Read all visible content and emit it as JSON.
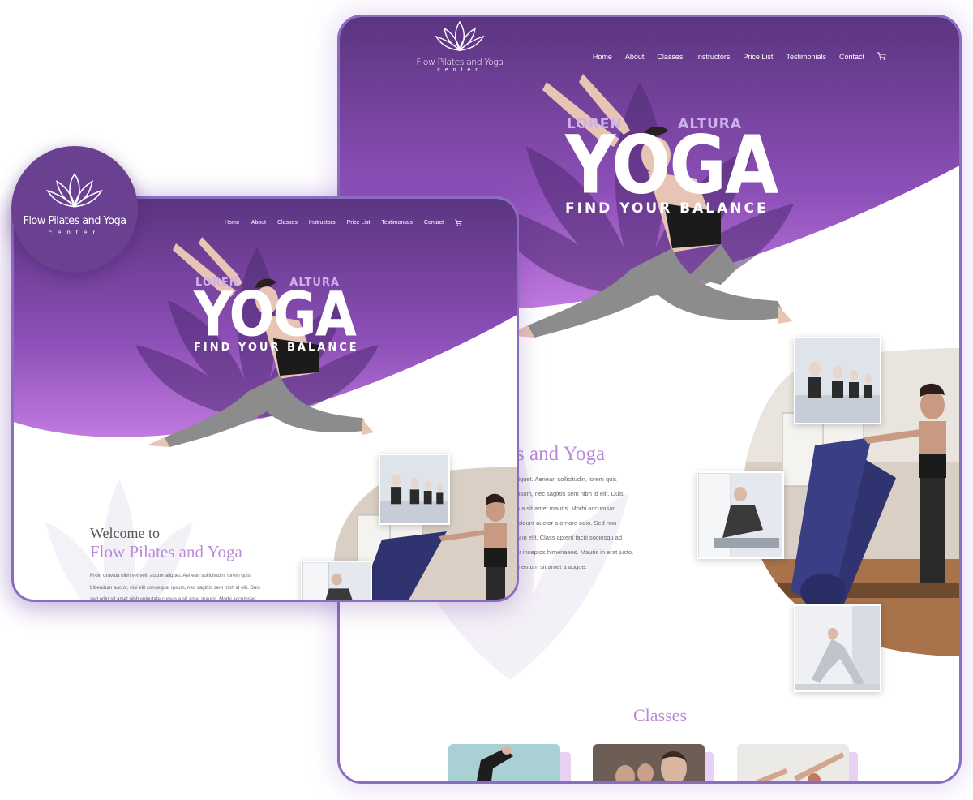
{
  "brand": {
    "name": "Flow Pilates and Yoga",
    "subtitle": "center"
  },
  "nav": {
    "items": [
      "Home",
      "About",
      "Classes",
      "Instructors",
      "Price List",
      "Testimonials",
      "Contact"
    ],
    "cart_icon": "cart-icon"
  },
  "hero": {
    "small_left": "LOREN",
    "small_right": "ALTURA",
    "big": "YOGA",
    "tagline": "FIND YOUR BALANCE"
  },
  "welcome": {
    "line1": "Welcome to",
    "line2": "Flow Pilates and Yoga",
    "body_back": [
      "ctor aliquet. Aenean sollicitudin, lorem quis",
      "quat ipsum, nec sagittis sem nibh id elit. Duis",
      "cursus a sit amet mauris. Morbi accumsan",
      "dio tincidunt auctor a ornare odio. Sed non",
      "ctor eu in elit. Class aptent taciti sociosqu ad",
      "tra, per inceptos himenaeos. Mauris in erat justo.",
      "condimentum sit amet a augue."
    ],
    "body_front": [
      "Proin gravida nibh vel velit auctor aliquet. Aenean sollicitudin, lorem quis",
      "bibendum auctor, nisi elit consequat ipsum, nec sagittis sem nibh id elit. Duis",
      "sed odio sit amet nibh vulputate cursus a sit amet mauris. Morbi accumsan"
    ],
    "back_line1": "to",
    "back_line2": "tes and Yoga"
  },
  "classes": {
    "title": "Classes"
  },
  "colors": {
    "purple_dark": "#5b3580",
    "purple_mid": "#8d4fb8",
    "purple_light": "#c07ae0",
    "accent_text": "#b98ad8",
    "border": "#8a6cc3"
  }
}
